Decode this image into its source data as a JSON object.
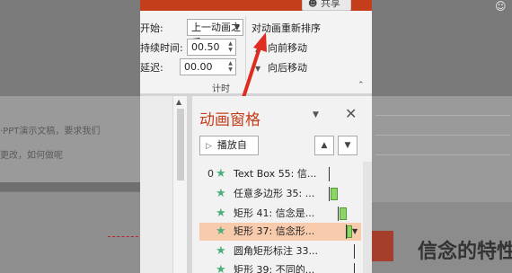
{
  "ribbon": {
    "share_label": "共享",
    "start_label": "开始:",
    "start_value": "上一动画之后",
    "duration_label": "持续时间:",
    "duration_value": "00.50",
    "delay_label": "延迟:",
    "delay_value": "00.00",
    "reorder_title": "对动画重新排序",
    "move_earlier": "向前移动",
    "move_later": "向后移动",
    "group_label": "计时"
  },
  "document": {
    "line1": "·PPT演示文稿，要求我们",
    "line2": "更改，如何做呢"
  },
  "animation_pane": {
    "title": "动画窗格",
    "play_label": "播放自",
    "rows": [
      {
        "num": "0",
        "label": "Text Box 55: 信..."
      },
      {
        "num": "",
        "label": "任意多边形 35: ..."
      },
      {
        "num": "",
        "label": "矩形 41: 信念是..."
      },
      {
        "num": "",
        "label": "矩形 37: 信念形..."
      },
      {
        "num": "",
        "label": "圆角矩形标注 33..."
      },
      {
        "num": "",
        "label": "矩形 39: 不同的..."
      }
    ]
  },
  "slide": {
    "heading": "信念的特性"
  },
  "colors": {
    "accent": "#c43e1c",
    "anim_star": "#4caf7d",
    "timeline_bar": "#8fd46a",
    "selected_row": "#f8cbad"
  }
}
